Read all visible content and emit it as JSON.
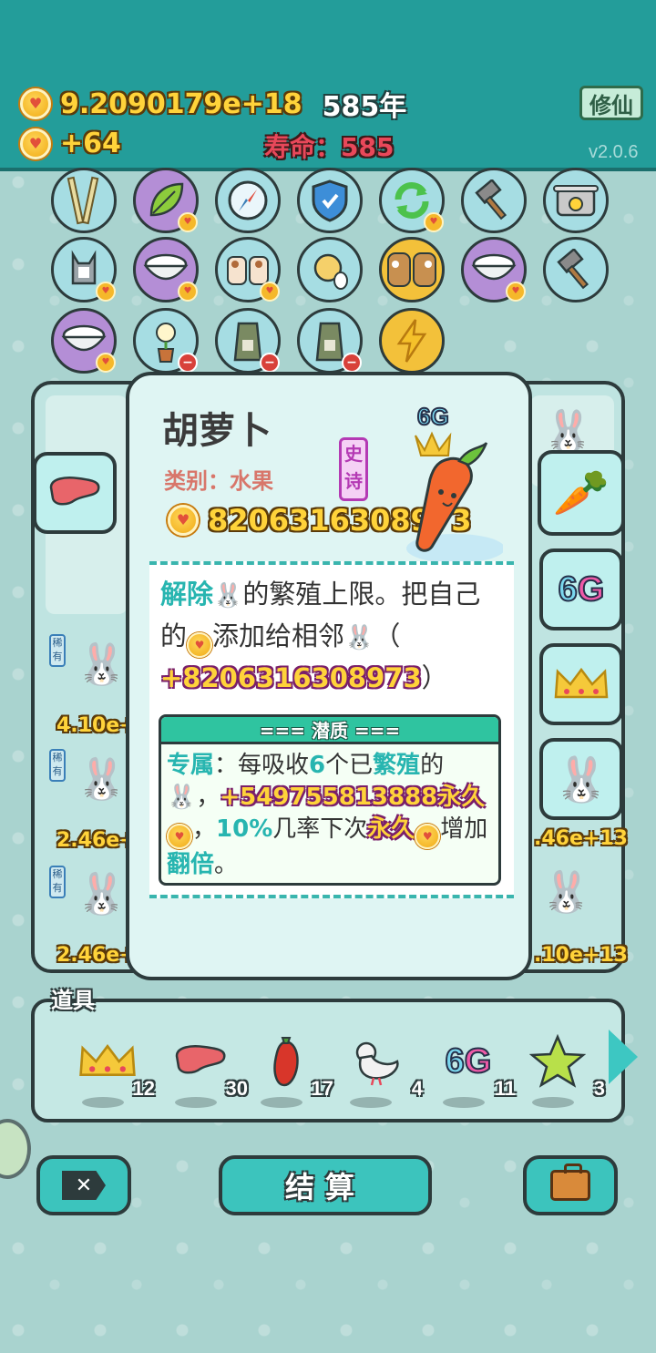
{
  "header": {
    "money": "9.2090179e+18",
    "years": "585年",
    "income": "+64",
    "lifespan": "寿命：585",
    "cultivate_button": "修仙",
    "version": "v2.0.6"
  },
  "icons": {
    "heart_glyph": "♥",
    "minus_glyph": "−"
  },
  "board": {
    "values": [
      "4.10e+",
      "2.46e+",
      "2.46e+"
    ],
    "right_values": [
      ".46e+13",
      ".10e+13"
    ],
    "rare_tag": "稀有"
  },
  "popup": {
    "title": "胡萝卜",
    "category": "类别：水果",
    "rarity": "史诗",
    "value": "8206316308973",
    "level_tag": "6G",
    "desc_part1": "解除",
    "desc_part2": "的繁殖上限。把自己的",
    "desc_part3": "添加给相邻",
    "desc_part4": "（",
    "desc_amount": "+8206316308973",
    "desc_part5": "）",
    "potential_header": "=== 潜质 ===",
    "pot_exclusive": "专属",
    "pot_t1": "：每吸收",
    "pot_num": "6",
    "pot_t2": "个已",
    "pot_bred": "繁殖",
    "pot_t3": "的",
    "pot_amount": "+549755813888永久",
    "pot_t4": "，",
    "pot_pct": "10%",
    "pot_t5": "几率下次",
    "pot_perm": "永久",
    "pot_t6": "增加",
    "pot_double": "翻倍",
    "pot_t7": "。"
  },
  "props": {
    "label": "道具",
    "items": [
      {
        "name": "crown",
        "count": "12"
      },
      {
        "name": "liver",
        "count": "30"
      },
      {
        "name": "chili",
        "count": "17"
      },
      {
        "name": "dove",
        "count": "4"
      },
      {
        "name": "6G",
        "count": "11"
      },
      {
        "name": "star",
        "count": "3"
      }
    ]
  },
  "buttons": {
    "settle": "结算"
  }
}
